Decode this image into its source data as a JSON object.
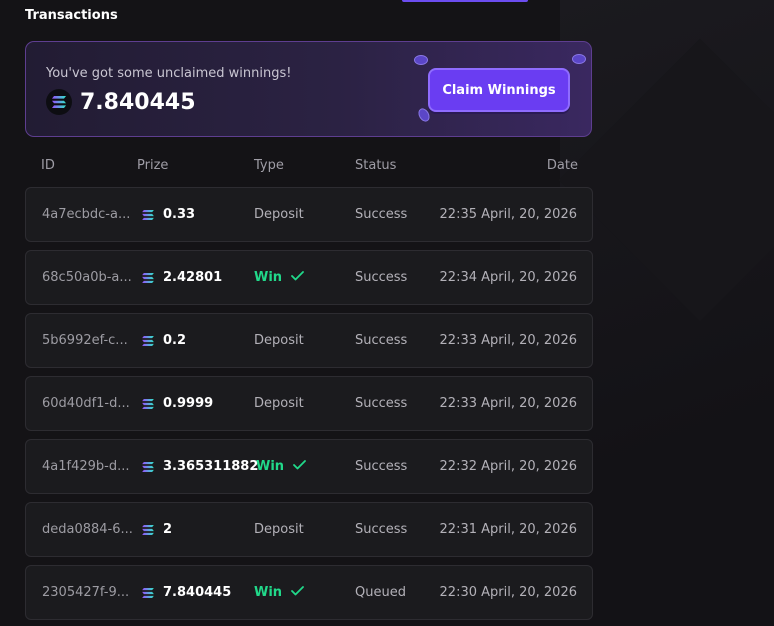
{
  "page": {
    "title": "Transactions"
  },
  "banner": {
    "message": "You've got some unclaimed winnings!",
    "amount": "7.840445",
    "claim_label": "Claim Winnings"
  },
  "table": {
    "columns": [
      "ID",
      "Prize",
      "Type",
      "Status",
      "Date"
    ],
    "rows": [
      {
        "id": "4a7ecbdc-a...",
        "prize": "0.33",
        "type": "Deposit",
        "win": false,
        "status": "Success",
        "date": "22:35 April, 20, 2026"
      },
      {
        "id": "68c50a0b-a...",
        "prize": "2.42801",
        "type": "Win",
        "win": true,
        "status": "Success",
        "date": "22:34 April, 20, 2026"
      },
      {
        "id": "5b6992ef-c...",
        "prize": "0.2",
        "type": "Deposit",
        "win": false,
        "status": "Success",
        "date": "22:33 April, 20, 2026"
      },
      {
        "id": "60d40df1-d...",
        "prize": "0.9999",
        "type": "Deposit",
        "win": false,
        "status": "Success",
        "date": "22:33 April, 20, 2026"
      },
      {
        "id": "4a1f429b-d...",
        "prize": "3.365311882",
        "type": "Win",
        "win": true,
        "status": "Success",
        "date": "22:32 April, 20, 2026"
      },
      {
        "id": "deda0884-6...",
        "prize": "2",
        "type": "Deposit",
        "win": false,
        "status": "Success",
        "date": "22:31 April, 20, 2026"
      },
      {
        "id": "2305427f-9...",
        "prize": "7.840445",
        "type": "Win",
        "win": true,
        "status": "Queued",
        "date": "22:30 April, 20, 2026"
      }
    ]
  },
  "colors": {
    "accent": "#6a3df2",
    "win": "#21d98a",
    "row_bg": "#1b1b1e"
  },
  "icons": {
    "currency": "solana-icon",
    "win_mark": "check-icon"
  }
}
